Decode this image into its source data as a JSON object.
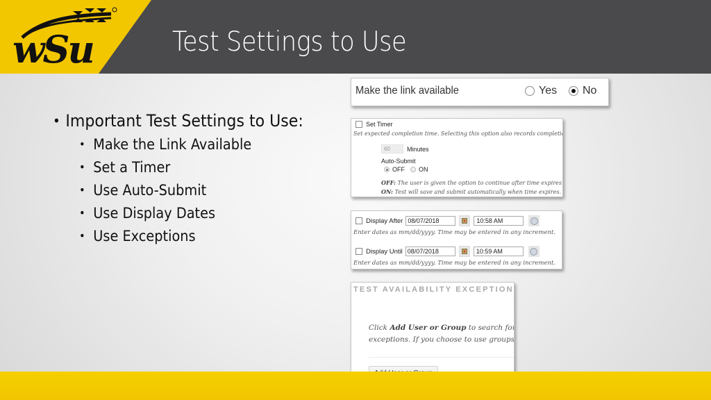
{
  "header": {
    "title": "Test Settings to Use",
    "logo_text": "WSU",
    "logo_registered": "®",
    "colors": {
      "yellow": "#f3c700",
      "dark": "#4a4a4c"
    }
  },
  "bullets": {
    "main": "Important Test Settings to Use:",
    "items": [
      "Make the Link Available",
      "Set a Timer",
      "Use Auto-Submit",
      "Use Display Dates",
      "Use Exceptions"
    ]
  },
  "link_panel": {
    "label": "Make the link available",
    "options": [
      {
        "label": "Yes",
        "selected": false
      },
      {
        "label": "No",
        "selected": true
      }
    ]
  },
  "timer_panel": {
    "checkbox_label": "Set Timer",
    "checked": false,
    "note": "Set expected completion time. Selecting this option also records completion ti",
    "minutes_value": "60",
    "minutes_label": "Minutes",
    "auto_submit_label": "Auto-Submit",
    "auto_submit_options": [
      {
        "label": "OFF",
        "selected": true
      },
      {
        "label": "ON",
        "selected": false
      }
    ],
    "off_desc_label": "OFF:",
    "off_desc": " The user is given the option to continue after time expires.",
    "on_desc_label": "ON:",
    "on_desc": " Test will save and submit automatically when time expires."
  },
  "dates_panel": {
    "rows": [
      {
        "label": "Display After",
        "date": "08/07/2018",
        "time": "10:58 AM",
        "checked": false
      },
      {
        "label": "Display Until",
        "date": "08/07/2018",
        "time": "10:59 AM",
        "checked": false
      }
    ],
    "note": "Enter dates as mm/dd/yyyy. Time may be entered in any increment."
  },
  "exceptions_panel": {
    "title": "TEST AVAILABILITY EXCEPTIONS",
    "text1_prefix": "Click ",
    "text1_bold": "Add User or Group",
    "text1_suffix": " to search for a",
    "text2": "exceptions. If you choose to use groups, yo",
    "button_label": "Add User or Group"
  }
}
